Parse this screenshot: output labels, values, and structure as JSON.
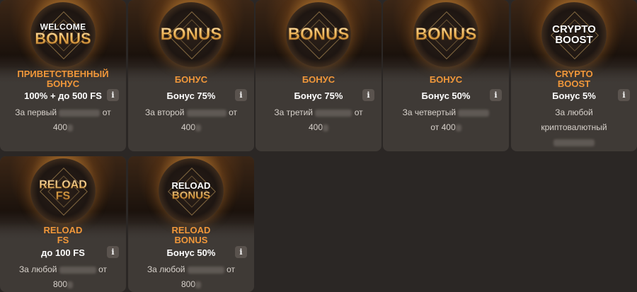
{
  "cards": [
    {
      "art_lines": [
        "WELCOME",
        "BONUS"
      ],
      "title": "ПРИВЕТСТВЕННЫЙ БОНУС",
      "amount": "100% + до 500 FS",
      "desc_prefix": "За первый",
      "desc_suffix": "от",
      "desc_line2": "400",
      "info_icon": "i"
    },
    {
      "art_lines": [
        "BONUS"
      ],
      "title": "БОНУС",
      "amount": "Бонус 75%",
      "desc_prefix": "За второй",
      "desc_suffix": "от",
      "desc_line2": "400",
      "info_icon": "i"
    },
    {
      "art_lines": [
        "BONUS"
      ],
      "title": "БОНУС",
      "amount": "Бонус 75%",
      "desc_prefix": "За третий",
      "desc_suffix": "от",
      "desc_line2": "400",
      "info_icon": "i"
    },
    {
      "art_lines": [
        "BONUS"
      ],
      "title": "БОНУС",
      "amount": "Бонус 50%",
      "desc_prefix": "За четвертый",
      "desc_suffix": "",
      "desc_line2": "от 400",
      "info_icon": "i"
    },
    {
      "art_lines": [
        "CRYPTO",
        "BOOST"
      ],
      "title": "CRYPTO BOOST",
      "amount": "Бонус 5%",
      "desc_prefix": "За любой",
      "desc_suffix": "",
      "desc_line2": "криптовалютный",
      "info_icon": "i"
    },
    {
      "art_lines": [
        "RELOAD FS"
      ],
      "title": "RELOAD FS",
      "amount": "до 100 FS",
      "desc_prefix": "За любой",
      "desc_suffix": "от",
      "desc_line2": "800",
      "info_icon": "i"
    },
    {
      "art_lines": [
        "RELOAD",
        "BONUS"
      ],
      "title": "RELOAD BONUS",
      "amount": "Бонус 50%",
      "desc_prefix": "За любой",
      "desc_suffix": "от",
      "desc_line2": "800",
      "info_icon": "i"
    }
  ],
  "colors": {
    "page_bg": "#2b2725",
    "card_bg": "#3f3a36",
    "title_orange": "#f0973a",
    "info_bg": "#5a534e"
  }
}
